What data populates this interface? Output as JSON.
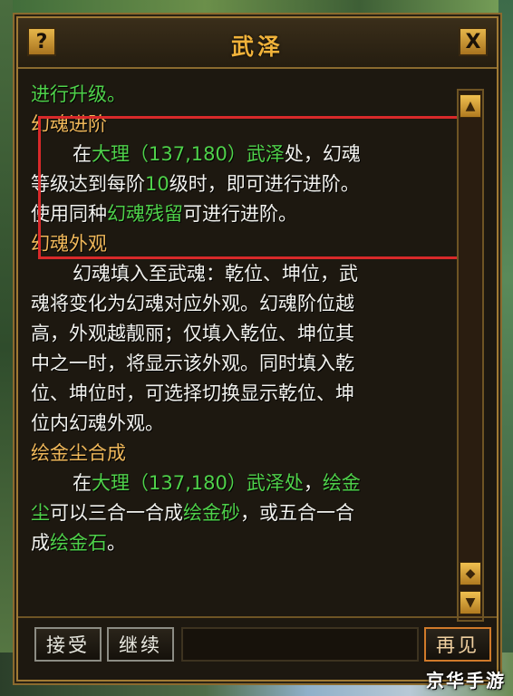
{
  "window": {
    "title": "武泽",
    "help_label": "?",
    "close_label": "X"
  },
  "content": {
    "intro_line": "进行升级。",
    "sections": [
      {
        "heading": "幻魂进阶",
        "lines": [
          [
            "在",
            "大理（137,180）武泽",
            "处，幻魂"
          ],
          [
            "等级达到每阶",
            "10",
            "级时，即可进行进阶。"
          ],
          [
            "使用同种",
            "幻魂残留",
            "可进行进阶。"
          ]
        ]
      },
      {
        "heading": "幻魂外观",
        "lines": [
          "幻魂填入至武魂：乾位、坤位，武",
          "魂将变化为幻魂对应外观。幻魂阶位越",
          "高，外观越靓丽；仅填入乾位、坤位其",
          "中之一时，将显示该外观。同时填入乾",
          "位、坤位时，可选择切换显示乾位、坤",
          "位内幻魂外观。"
        ]
      },
      {
        "heading": "绘金尘合成",
        "lines": [
          [
            "在",
            "大理（137,180）武泽处",
            "，",
            "绘金"
          ],
          [
            "尘",
            "可以三合一合成",
            "绘金砂",
            "，或五合一合"
          ],
          [
            "成",
            "绘金石",
            "。"
          ]
        ]
      }
    ]
  },
  "buttons": {
    "accept": "接受",
    "continue": "继续",
    "bye": "再见"
  },
  "scroll": {
    "up_label": "▲",
    "down_label": "▼",
    "mid_label": "◆"
  },
  "watermark": "京华手游",
  "colors": {
    "heading": "#f0b85a",
    "highlight_text": "#4fd14a",
    "body_text": "#f2f2ee",
    "highlight_box": "#d8292a"
  }
}
